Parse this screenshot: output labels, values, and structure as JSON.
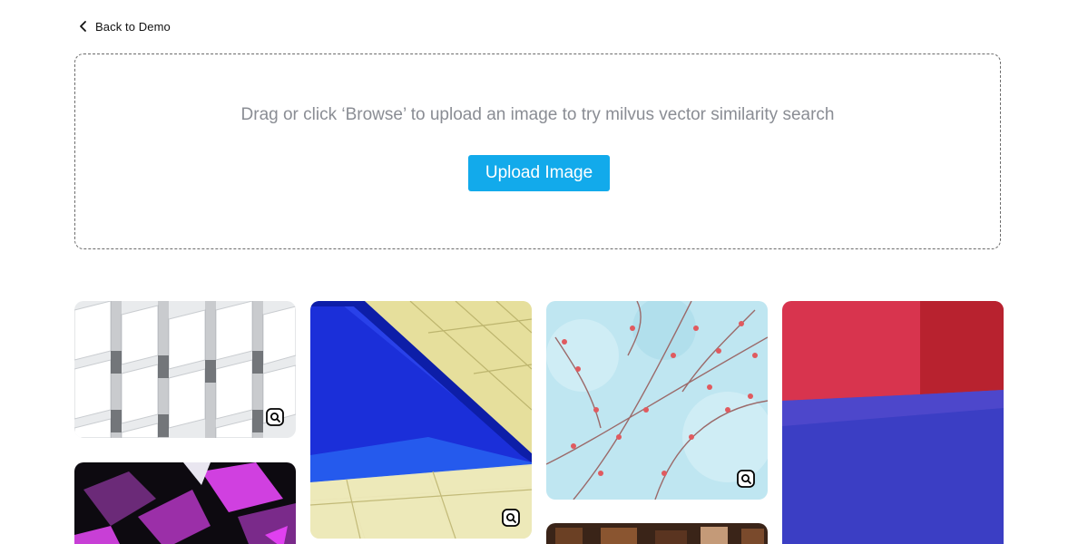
{
  "nav": {
    "back_label": "Back to Demo",
    "back_icon": "chevron-left-icon"
  },
  "upload": {
    "hint": "Drag or click ‘Browse’ to upload an image to try milvus vector similarity search",
    "button_label": "Upload Image",
    "button_color": "#12aaeb"
  },
  "gallery": {
    "badge_icon": "image-search-icon",
    "images": [
      {
        "subject": "white-facade",
        "has_search_badge": true
      },
      {
        "subject": "pool",
        "has_search_badge": true
      },
      {
        "subject": "blossom-branches",
        "has_search_badge": true
      },
      {
        "subject": "red-blue-room",
        "has_search_badge": false
      },
      {
        "subject": "purple-foil",
        "has_search_badge": false
      },
      {
        "subject": "interior",
        "has_search_badge": false
      }
    ]
  }
}
